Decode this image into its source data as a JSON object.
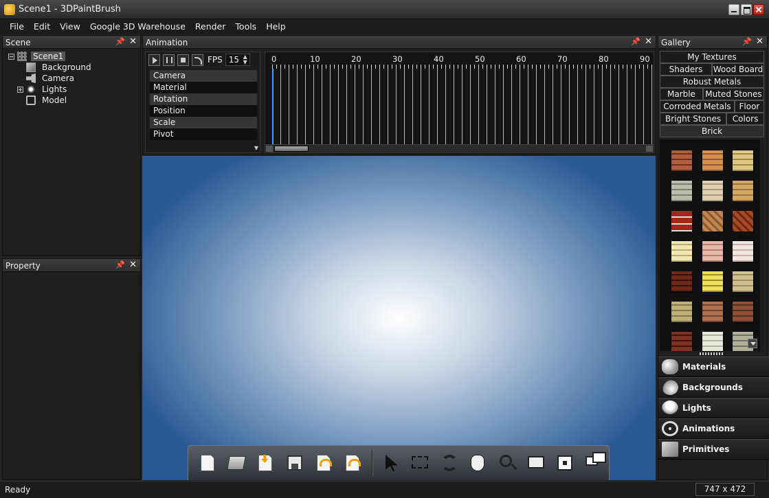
{
  "window": {
    "title": "Scene1 - 3DPaintBrush"
  },
  "menu": [
    "File",
    "Edit",
    "View",
    "Google 3D Warehouse",
    "Render",
    "Tools",
    "Help"
  ],
  "scene_panel": {
    "title": "Scene",
    "items": [
      {
        "label": "Scene1",
        "icon": "grid-icon",
        "selected": true
      },
      {
        "label": "Background",
        "icon": "background-icon"
      },
      {
        "label": "Camera",
        "icon": "camera-icon"
      },
      {
        "label": "Lights",
        "icon": "light-icon"
      },
      {
        "label": "Model",
        "icon": "model-icon"
      }
    ]
  },
  "property_panel": {
    "title": "Property"
  },
  "animation_panel": {
    "title": "Animation",
    "fps_label": "FPS",
    "fps_value": "15",
    "tracks": [
      "Camera",
      "Material",
      "Rotation",
      "Position",
      "Scale",
      "Pivot"
    ],
    "ruler_labels": [
      "0",
      "10",
      "20",
      "30",
      "40",
      "50",
      "60",
      "70",
      "80",
      "90"
    ]
  },
  "gallery_panel": {
    "title": "Gallery",
    "tab_rows": [
      [
        "My Textures"
      ],
      [
        "Shaders",
        "Wood Board"
      ],
      [
        "Robust Metals"
      ],
      [
        "Marble",
        "Muted Stones"
      ],
      [
        "Corroded Metals",
        "Floor"
      ],
      [
        "Bright Stones",
        "Colors"
      ],
      [
        "Brick"
      ]
    ],
    "active_tab": "Brick",
    "accordion": [
      {
        "label": "Materials",
        "icon": "materials-icon"
      },
      {
        "label": "Backgrounds",
        "icon": "backgrounds-icon"
      },
      {
        "label": "Lights",
        "icon": "lights-icon"
      },
      {
        "label": "Animations",
        "icon": "animations-icon"
      },
      {
        "label": "Primitives",
        "icon": "primitives-icon"
      }
    ]
  },
  "toolbar": {
    "buttons": [
      "new-icon",
      "open-icon",
      "import-icon",
      "save-icon",
      "undo-icon",
      "redo-icon",
      "select-arrow-icon",
      "select-rect-icon",
      "rotate-icon",
      "pan-hand-icon",
      "zoom-icon",
      "zoom-rect-icon",
      "fit-view-icon",
      "windows-icon"
    ]
  },
  "status": {
    "text": "Ready",
    "dims": "747 x 472"
  },
  "colors": {
    "viewport_center": "#ffffff",
    "viewport_edge": "#2a5a93",
    "timeline_cursor": "#4aa0ff"
  }
}
